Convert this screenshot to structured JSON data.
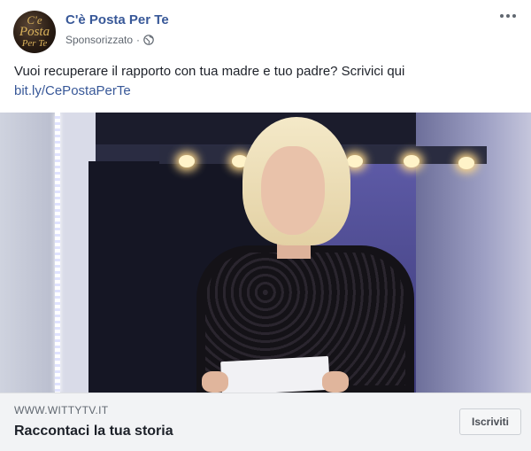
{
  "post": {
    "page_name": "C'è Posta Per Te",
    "sponsored_label": "Sponsorizzato",
    "separator": "·",
    "avatar_logo": [
      "C'e",
      "Posta",
      "Per Te"
    ],
    "more_icon": "more-horizontal-icon",
    "privacy_icon": "globe-icon",
    "message": "Vuoi recuperare il rapporto con tua madre e tuo padre? Scrivici qui",
    "link": "bit.ly/CePostaPerTe"
  },
  "link_preview": {
    "domain": "WWW.WITTYTV.IT",
    "headline": "Raccontaci la tua storia",
    "cta_label": "Iscriviti"
  },
  "colors": {
    "link_blue": "#385898",
    "text": "#1d2129",
    "secondary_text": "#606770",
    "footer_bg": "#f2f3f5"
  }
}
